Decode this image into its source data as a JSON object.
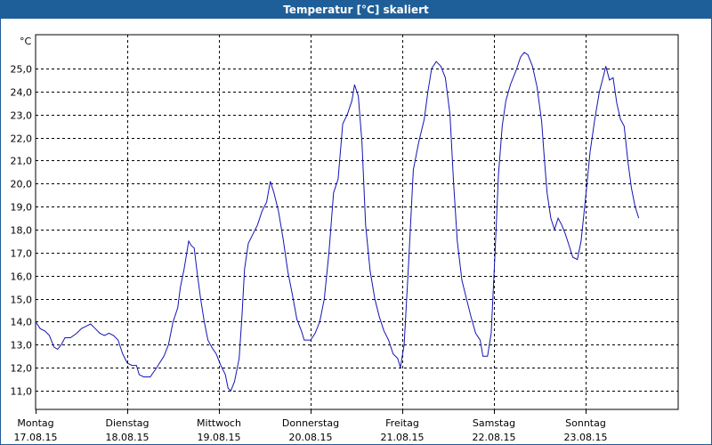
{
  "window": {
    "title": "Temperatur [°C] skaliert"
  },
  "colors": {
    "titlebar": "#1f5f99",
    "series": "#1414b4",
    "grid": "#000000"
  },
  "chart_data": {
    "type": "line",
    "title": "Temperatur [°C] skaliert",
    "ylabel": "°C",
    "xlabel": "",
    "ylim": [
      10.0,
      26.0
    ],
    "xlim": [
      0,
      7
    ],
    "x_unit": "days from first midnight tick",
    "grid": true,
    "y_ticks": [
      "11,0",
      "12,0",
      "13,0",
      "14,0",
      "15,0",
      "16,0",
      "17,0",
      "18,0",
      "19,0",
      "20,0",
      "21,0",
      "22,0",
      "23,0",
      "24,0",
      "25,0"
    ],
    "x_ticks": [
      {
        "day": "Montag",
        "date": "17.08.15"
      },
      {
        "day": "Dienstag",
        "date": "18.08.15"
      },
      {
        "day": "Mittwoch",
        "date": "19.08.15"
      },
      {
        "day": "Donnerstag",
        "date": "20.08.15"
      },
      {
        "day": "Freitag",
        "date": "21.08.15"
      },
      {
        "day": "Samstag",
        "date": "22.08.15"
      },
      {
        "day": "Sonntag",
        "date": "23.08.15"
      }
    ],
    "series": [
      {
        "points": [
          [
            0.0,
            14.0
          ],
          [
            0.05,
            13.7
          ],
          [
            0.1,
            13.6
          ],
          [
            0.15,
            13.4
          ],
          [
            0.2,
            12.9
          ],
          [
            0.24,
            12.8
          ],
          [
            0.28,
            13.0
          ],
          [
            0.32,
            13.3
          ],
          [
            0.38,
            13.3
          ],
          [
            0.45,
            13.5
          ],
          [
            0.5,
            13.7
          ],
          [
            0.55,
            13.8
          ],
          [
            0.6,
            13.9
          ],
          [
            0.65,
            13.7
          ],
          [
            0.7,
            13.5
          ],
          [
            0.75,
            13.4
          ],
          [
            0.8,
            13.5
          ],
          [
            0.85,
            13.4
          ],
          [
            0.9,
            13.2
          ],
          [
            0.95,
            12.6
          ],
          [
            1.0,
            12.2
          ],
          [
            1.05,
            12.1
          ],
          [
            1.1,
            12.1
          ],
          [
            1.13,
            11.7
          ],
          [
            1.18,
            11.6
          ],
          [
            1.25,
            11.6
          ],
          [
            1.32,
            12.0
          ],
          [
            1.4,
            12.5
          ],
          [
            1.45,
            13.0
          ],
          [
            1.5,
            14.0
          ],
          [
            1.55,
            14.6
          ],
          [
            1.58,
            15.5
          ],
          [
            1.62,
            16.3
          ],
          [
            1.65,
            17.0
          ],
          [
            1.67,
            17.5
          ],
          [
            1.7,
            17.3
          ],
          [
            1.73,
            17.2
          ],
          [
            1.76,
            16.2
          ],
          [
            1.8,
            15.0
          ],
          [
            1.84,
            14.0
          ],
          [
            1.88,
            13.2
          ],
          [
            1.92,
            12.9
          ],
          [
            1.97,
            12.6
          ],
          [
            2.02,
            12.1
          ],
          [
            2.07,
            11.7
          ],
          [
            2.1,
            11.1
          ],
          [
            2.13,
            11.0
          ],
          [
            2.17,
            11.4
          ],
          [
            2.22,
            12.4
          ],
          [
            2.25,
            14.2
          ],
          [
            2.28,
            16.3
          ],
          [
            2.32,
            17.4
          ],
          [
            2.37,
            17.8
          ],
          [
            2.42,
            18.2
          ],
          [
            2.47,
            18.8
          ],
          [
            2.52,
            19.2
          ],
          [
            2.56,
            20.1
          ],
          [
            2.6,
            19.6
          ],
          [
            2.65,
            18.8
          ],
          [
            2.7,
            17.6
          ],
          [
            2.75,
            16.2
          ],
          [
            2.8,
            15.2
          ],
          [
            2.85,
            14.1
          ],
          [
            2.9,
            13.6
          ],
          [
            2.93,
            13.2
          ],
          [
            2.97,
            13.2
          ],
          [
            3.0,
            13.2
          ],
          [
            3.05,
            13.5
          ],
          [
            3.1,
            14.0
          ],
          [
            3.15,
            15.0
          ],
          [
            3.2,
            17.0
          ],
          [
            3.25,
            19.6
          ],
          [
            3.3,
            20.2
          ],
          [
            3.35,
            22.6
          ],
          [
            3.4,
            23.0
          ],
          [
            3.45,
            23.6
          ],
          [
            3.48,
            24.3
          ],
          [
            3.52,
            23.8
          ],
          [
            3.56,
            21.8
          ],
          [
            3.6,
            18.2
          ],
          [
            3.65,
            16.2
          ],
          [
            3.7,
            15.0
          ],
          [
            3.75,
            14.2
          ],
          [
            3.8,
            13.6
          ],
          [
            3.85,
            13.2
          ],
          [
            3.9,
            12.6
          ],
          [
            3.95,
            12.4
          ],
          [
            3.98,
            12.0
          ],
          [
            4.02,
            13.0
          ],
          [
            4.07,
            16.6
          ],
          [
            4.12,
            20.6
          ],
          [
            4.18,
            21.8
          ],
          [
            4.24,
            22.8
          ],
          [
            4.28,
            24.0
          ],
          [
            4.32,
            25.0
          ],
          [
            4.37,
            25.3
          ],
          [
            4.42,
            25.1
          ],
          [
            4.47,
            24.6
          ],
          [
            4.52,
            23.0
          ],
          [
            4.56,
            20.0
          ],
          [
            4.6,
            17.5
          ],
          [
            4.65,
            15.8
          ],
          [
            4.7,
            15.0
          ],
          [
            4.75,
            14.2
          ],
          [
            4.8,
            13.5
          ],
          [
            4.85,
            13.2
          ],
          [
            4.88,
            12.5
          ],
          [
            4.93,
            12.5
          ],
          [
            4.97,
            13.5
          ],
          [
            5.01,
            16.8
          ],
          [
            5.05,
            20.4
          ],
          [
            5.09,
            22.5
          ],
          [
            5.13,
            23.6
          ],
          [
            5.18,
            24.3
          ],
          [
            5.24,
            24.9
          ],
          [
            5.29,
            25.5
          ],
          [
            5.33,
            25.7
          ],
          [
            5.37,
            25.6
          ],
          [
            5.42,
            25.1
          ],
          [
            5.47,
            24.2
          ],
          [
            5.52,
            22.7
          ],
          [
            5.55,
            21.1
          ],
          [
            5.58,
            19.6
          ],
          [
            5.62,
            18.5
          ],
          [
            5.66,
            18.0
          ],
          [
            5.7,
            18.5
          ],
          [
            5.74,
            18.2
          ],
          [
            5.78,
            17.8
          ],
          [
            5.82,
            17.3
          ],
          [
            5.86,
            16.8
          ],
          [
            5.91,
            16.7
          ],
          [
            5.95,
            17.5
          ],
          [
            6.0,
            19.4
          ],
          [
            6.05,
            21.4
          ],
          [
            6.1,
            22.8
          ],
          [
            6.15,
            24.0
          ],
          [
            6.19,
            24.6
          ],
          [
            6.22,
            25.1
          ],
          [
            6.26,
            24.5
          ],
          [
            6.3,
            24.6
          ],
          [
            6.34,
            23.5
          ],
          [
            6.38,
            22.8
          ],
          [
            6.42,
            22.5
          ],
          [
            6.46,
            21.0
          ],
          [
            6.5,
            19.8
          ],
          [
            6.54,
            19.0
          ],
          [
            6.58,
            18.5
          ]
        ]
      }
    ]
  }
}
